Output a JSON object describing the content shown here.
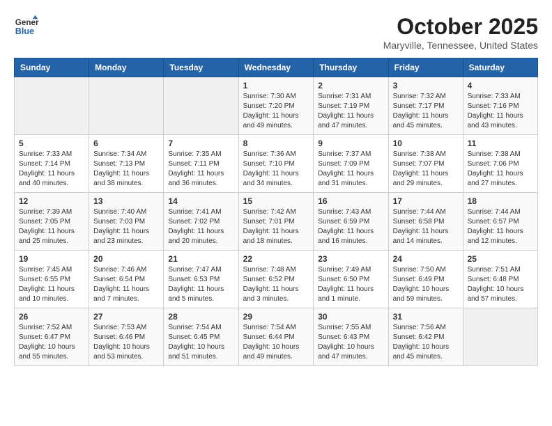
{
  "header": {
    "logo_line1": "General",
    "logo_line2": "Blue",
    "month": "October 2025",
    "location": "Maryville, Tennessee, United States"
  },
  "weekdays": [
    "Sunday",
    "Monday",
    "Tuesday",
    "Wednesday",
    "Thursday",
    "Friday",
    "Saturday"
  ],
  "weeks": [
    [
      {
        "day": "",
        "sunrise": "",
        "sunset": "",
        "daylight": ""
      },
      {
        "day": "",
        "sunrise": "",
        "sunset": "",
        "daylight": ""
      },
      {
        "day": "",
        "sunrise": "",
        "sunset": "",
        "daylight": ""
      },
      {
        "day": "1",
        "sunrise": "Sunrise: 7:30 AM",
        "sunset": "Sunset: 7:20 PM",
        "daylight": "Daylight: 11 hours and 49 minutes."
      },
      {
        "day": "2",
        "sunrise": "Sunrise: 7:31 AM",
        "sunset": "Sunset: 7:19 PM",
        "daylight": "Daylight: 11 hours and 47 minutes."
      },
      {
        "day": "3",
        "sunrise": "Sunrise: 7:32 AM",
        "sunset": "Sunset: 7:17 PM",
        "daylight": "Daylight: 11 hours and 45 minutes."
      },
      {
        "day": "4",
        "sunrise": "Sunrise: 7:33 AM",
        "sunset": "Sunset: 7:16 PM",
        "daylight": "Daylight: 11 hours and 43 minutes."
      }
    ],
    [
      {
        "day": "5",
        "sunrise": "Sunrise: 7:33 AM",
        "sunset": "Sunset: 7:14 PM",
        "daylight": "Daylight: 11 hours and 40 minutes."
      },
      {
        "day": "6",
        "sunrise": "Sunrise: 7:34 AM",
        "sunset": "Sunset: 7:13 PM",
        "daylight": "Daylight: 11 hours and 38 minutes."
      },
      {
        "day": "7",
        "sunrise": "Sunrise: 7:35 AM",
        "sunset": "Sunset: 7:11 PM",
        "daylight": "Daylight: 11 hours and 36 minutes."
      },
      {
        "day": "8",
        "sunrise": "Sunrise: 7:36 AM",
        "sunset": "Sunset: 7:10 PM",
        "daylight": "Daylight: 11 hours and 34 minutes."
      },
      {
        "day": "9",
        "sunrise": "Sunrise: 7:37 AM",
        "sunset": "Sunset: 7:09 PM",
        "daylight": "Daylight: 11 hours and 31 minutes."
      },
      {
        "day": "10",
        "sunrise": "Sunrise: 7:38 AM",
        "sunset": "Sunset: 7:07 PM",
        "daylight": "Daylight: 11 hours and 29 minutes."
      },
      {
        "day": "11",
        "sunrise": "Sunrise: 7:38 AM",
        "sunset": "Sunset: 7:06 PM",
        "daylight": "Daylight: 11 hours and 27 minutes."
      }
    ],
    [
      {
        "day": "12",
        "sunrise": "Sunrise: 7:39 AM",
        "sunset": "Sunset: 7:05 PM",
        "daylight": "Daylight: 11 hours and 25 minutes."
      },
      {
        "day": "13",
        "sunrise": "Sunrise: 7:40 AM",
        "sunset": "Sunset: 7:03 PM",
        "daylight": "Daylight: 11 hours and 23 minutes."
      },
      {
        "day": "14",
        "sunrise": "Sunrise: 7:41 AM",
        "sunset": "Sunset: 7:02 PM",
        "daylight": "Daylight: 11 hours and 20 minutes."
      },
      {
        "day": "15",
        "sunrise": "Sunrise: 7:42 AM",
        "sunset": "Sunset: 7:01 PM",
        "daylight": "Daylight: 11 hours and 18 minutes."
      },
      {
        "day": "16",
        "sunrise": "Sunrise: 7:43 AM",
        "sunset": "Sunset: 6:59 PM",
        "daylight": "Daylight: 11 hours and 16 minutes."
      },
      {
        "day": "17",
        "sunrise": "Sunrise: 7:44 AM",
        "sunset": "Sunset: 6:58 PM",
        "daylight": "Daylight: 11 hours and 14 minutes."
      },
      {
        "day": "18",
        "sunrise": "Sunrise: 7:44 AM",
        "sunset": "Sunset: 6:57 PM",
        "daylight": "Daylight: 11 hours and 12 minutes."
      }
    ],
    [
      {
        "day": "19",
        "sunrise": "Sunrise: 7:45 AM",
        "sunset": "Sunset: 6:55 PM",
        "daylight": "Daylight: 11 hours and 10 minutes."
      },
      {
        "day": "20",
        "sunrise": "Sunrise: 7:46 AM",
        "sunset": "Sunset: 6:54 PM",
        "daylight": "Daylight: 11 hours and 7 minutes."
      },
      {
        "day": "21",
        "sunrise": "Sunrise: 7:47 AM",
        "sunset": "Sunset: 6:53 PM",
        "daylight": "Daylight: 11 hours and 5 minutes."
      },
      {
        "day": "22",
        "sunrise": "Sunrise: 7:48 AM",
        "sunset": "Sunset: 6:52 PM",
        "daylight": "Daylight: 11 hours and 3 minutes."
      },
      {
        "day": "23",
        "sunrise": "Sunrise: 7:49 AM",
        "sunset": "Sunset: 6:50 PM",
        "daylight": "Daylight: 11 hours and 1 minute."
      },
      {
        "day": "24",
        "sunrise": "Sunrise: 7:50 AM",
        "sunset": "Sunset: 6:49 PM",
        "daylight": "Daylight: 10 hours and 59 minutes."
      },
      {
        "day": "25",
        "sunrise": "Sunrise: 7:51 AM",
        "sunset": "Sunset: 6:48 PM",
        "daylight": "Daylight: 10 hours and 57 minutes."
      }
    ],
    [
      {
        "day": "26",
        "sunrise": "Sunrise: 7:52 AM",
        "sunset": "Sunset: 6:47 PM",
        "daylight": "Daylight: 10 hours and 55 minutes."
      },
      {
        "day": "27",
        "sunrise": "Sunrise: 7:53 AM",
        "sunset": "Sunset: 6:46 PM",
        "daylight": "Daylight: 10 hours and 53 minutes."
      },
      {
        "day": "28",
        "sunrise": "Sunrise: 7:54 AM",
        "sunset": "Sunset: 6:45 PM",
        "daylight": "Daylight: 10 hours and 51 minutes."
      },
      {
        "day": "29",
        "sunrise": "Sunrise: 7:54 AM",
        "sunset": "Sunset: 6:44 PM",
        "daylight": "Daylight: 10 hours and 49 minutes."
      },
      {
        "day": "30",
        "sunrise": "Sunrise: 7:55 AM",
        "sunset": "Sunset: 6:43 PM",
        "daylight": "Daylight: 10 hours and 47 minutes."
      },
      {
        "day": "31",
        "sunrise": "Sunrise: 7:56 AM",
        "sunset": "Sunset: 6:42 PM",
        "daylight": "Daylight: 10 hours and 45 minutes."
      },
      {
        "day": "",
        "sunrise": "",
        "sunset": "",
        "daylight": ""
      }
    ]
  ]
}
